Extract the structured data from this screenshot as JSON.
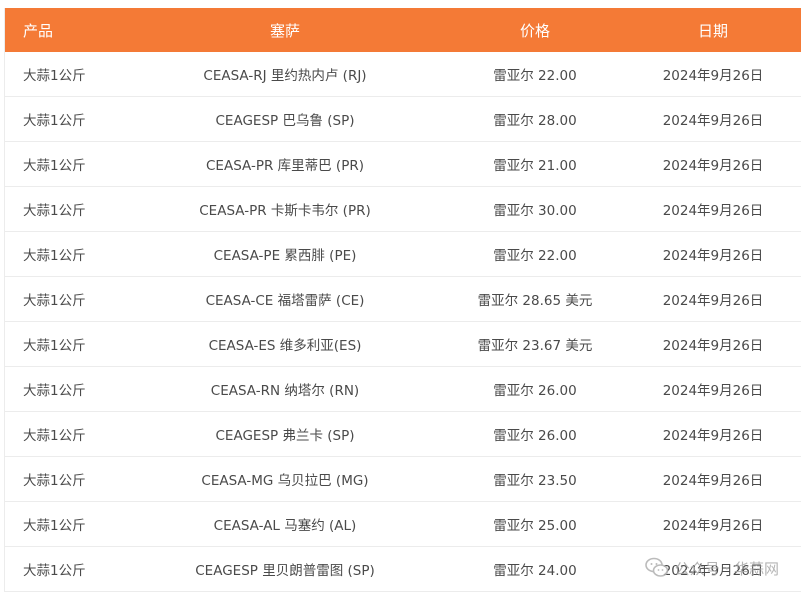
{
  "table": {
    "headers": [
      "产品",
      "塞萨",
      "价格",
      "日期"
    ],
    "rows": [
      [
        "大蒜1公斤",
        "CEASA-RJ 里约热内卢 (RJ)",
        "雷亚尔 22.00",
        "2024年9月26日"
      ],
      [
        "大蒜1公斤",
        "CEAGESP 巴乌鲁 (SP)",
        "雷亚尔 28.00",
        "2024年9月26日"
      ],
      [
        "大蒜1公斤",
        "CEASA-PR 库里蒂巴 (PR)",
        "雷亚尔 21.00",
        "2024年9月26日"
      ],
      [
        "大蒜1公斤",
        "CEASA-PR 卡斯卡韦尔 (PR)",
        "雷亚尔 30.00",
        "2024年9月26日"
      ],
      [
        "大蒜1公斤",
        "CEASA-PE 累西腓 (PE)",
        "雷亚尔 22.00",
        "2024年9月26日"
      ],
      [
        "大蒜1公斤",
        "CEASA-CE 福塔雷萨 (CE)",
        "雷亚尔 28.65 美元",
        "2024年9月26日"
      ],
      [
        "大蒜1公斤",
        "CEASA-ES 维多利亚(ES)",
        "雷亚尔 23.67 美元",
        "2024年9月26日"
      ],
      [
        "大蒜1公斤",
        "CEASA-RN 纳塔尔 (RN)",
        "雷亚尔 26.00",
        "2024年9月26日"
      ],
      [
        "大蒜1公斤",
        "CEAGESP 弗兰卡 (SP)",
        "雷亚尔 26.00",
        "2024年9月26日"
      ],
      [
        "大蒜1公斤",
        "CEASA-MG 乌贝拉巴 (MG)",
        "雷亚尔 23.50",
        "2024年9月26日"
      ],
      [
        "大蒜1公斤",
        "CEASA-AL 马塞约 (AL)",
        "雷亚尔 25.00",
        "2024年9月26日"
      ],
      [
        "大蒜1公斤",
        "CEAGESP 里贝朗普雷图 (SP)",
        "雷亚尔 24.00",
        "2024年9月26日"
      ]
    ]
  },
  "watermark": {
    "icon": "wechat-icon",
    "text": "公众号 · 华蒜网"
  },
  "colors": {
    "header_bg": "#f47a36",
    "header_text": "#ffffff",
    "cell_text": "#4a4a4a",
    "row_border": "#ececec",
    "watermark": "#a8a8a8"
  }
}
